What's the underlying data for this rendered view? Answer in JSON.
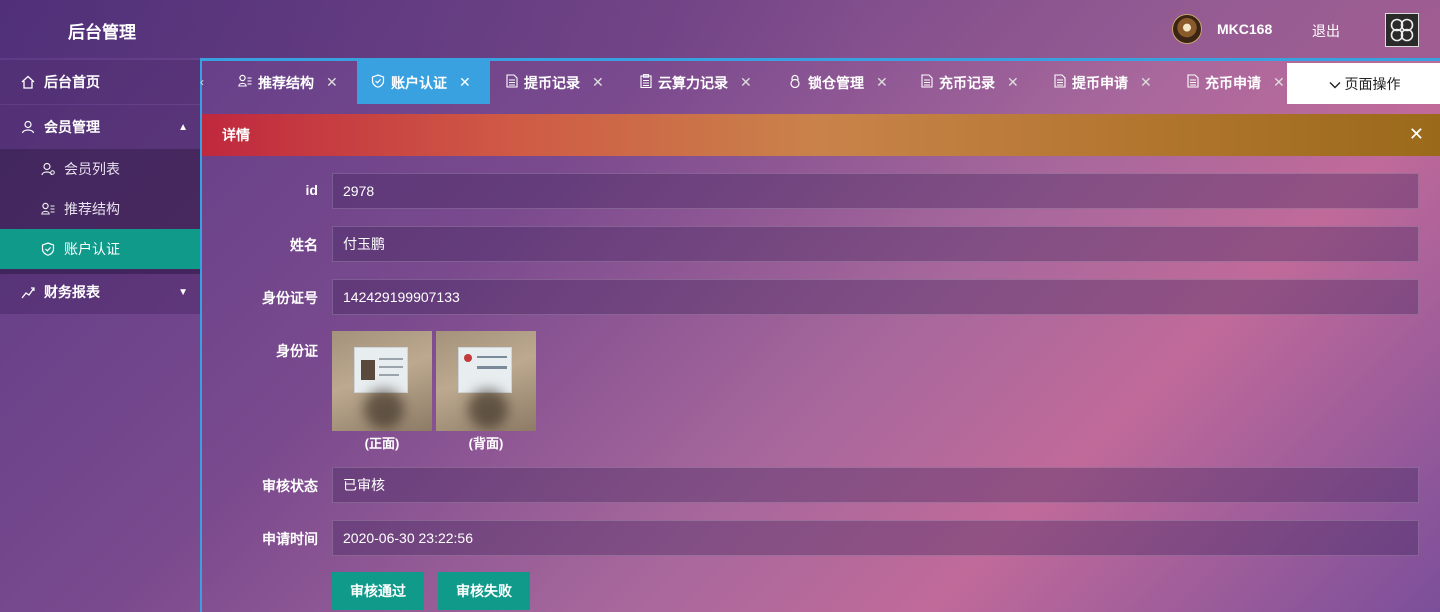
{
  "header": {
    "title": "后台管理",
    "username": "MKC168",
    "logout_label": "退出"
  },
  "sidebar": {
    "items": [
      {
        "label": "后台首页",
        "icon": "home-icon"
      },
      {
        "label": "会员管理",
        "icon": "user-icon",
        "expanded": true
      },
      {
        "label": "财务报表",
        "icon": "chart-icon",
        "expanded": false
      }
    ],
    "sub_items": [
      {
        "label": "会员列表",
        "icon": "user-list-icon"
      },
      {
        "label": "推荐结构",
        "icon": "referral-icon"
      },
      {
        "label": "账户认证",
        "icon": "shield-icon",
        "active": true
      }
    ]
  },
  "tabs": [
    {
      "label": "推荐结构",
      "icon": "referral-icon"
    },
    {
      "label": "账户认证",
      "icon": "shield-icon",
      "active": true
    },
    {
      "label": "提币记录",
      "icon": "document-icon"
    },
    {
      "label": "云算力记录",
      "icon": "clipboard-icon"
    },
    {
      "label": "锁仓管理",
      "icon": "lock-icon"
    },
    {
      "label": "充币记录",
      "icon": "document-icon"
    },
    {
      "label": "提币申请",
      "icon": "document-icon"
    },
    {
      "label": "充币申请",
      "icon": "document-icon"
    }
  ],
  "page_op_label": "页面操作",
  "dialog": {
    "title": "详情",
    "fields": {
      "id_label": "id",
      "id_value": "2978",
      "name_label": "姓名",
      "name_value": "付玉鹏",
      "idnum_label": "身份证号",
      "idnum_value": "142429199907133",
      "idcard_label": "身份证",
      "front_caption": "(正面)",
      "back_caption": "(背面)",
      "status_label": "审核状态",
      "status_value": "已审核",
      "time_label": "申请时间",
      "time_value": "2020-06-30 23:22:56"
    },
    "approve_label": "审核通过",
    "reject_label": "审核失败"
  },
  "colors": {
    "accent_teal": "#109a8a",
    "tab_active": "#3aa1e0"
  }
}
